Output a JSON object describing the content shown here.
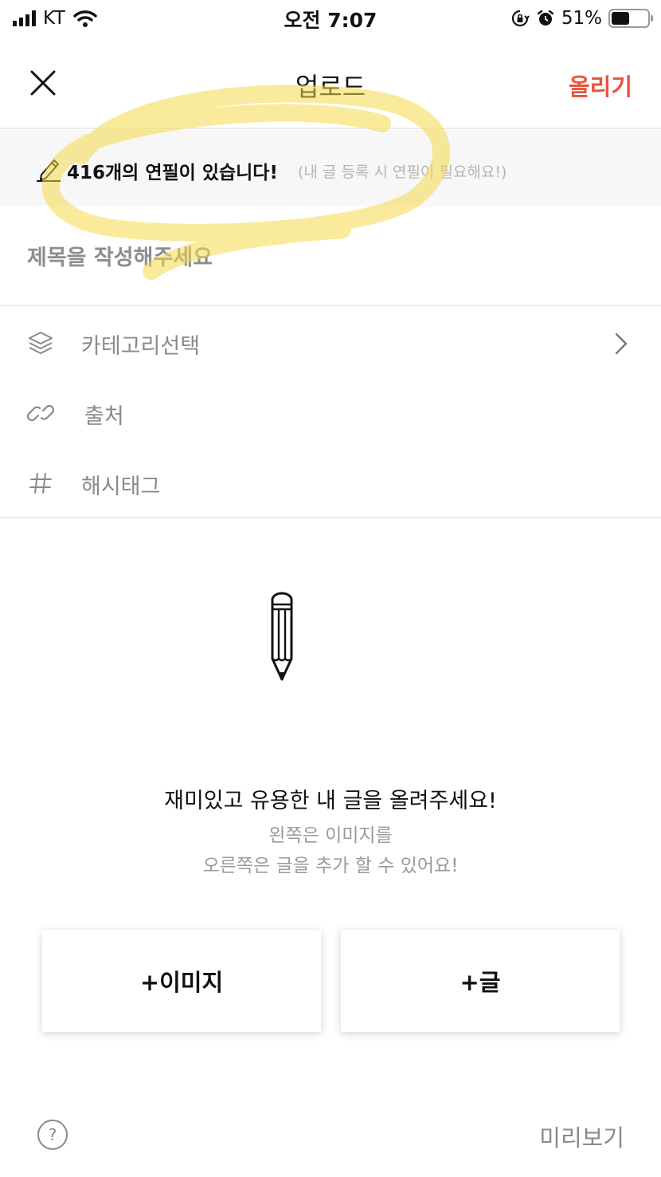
{
  "status_bar": {
    "carrier": "KT",
    "time": "오전 7:07",
    "battery_percent": "51%",
    "battery_level": 0.51,
    "icons": [
      "signal-icon",
      "wifi-icon",
      "rotation-lock-icon",
      "alarm-icon",
      "battery-icon"
    ]
  },
  "header": {
    "title": "업로드",
    "upload_label": "올리기",
    "close_icon": "close-icon"
  },
  "notice": {
    "main": "416개의 연필이 있습니다!",
    "sub": "(내 글 등록 시 연필이 필요해요!)",
    "icon": "pencil-icon"
  },
  "title_field": {
    "placeholder": "제목을 작성해주세요"
  },
  "options": [
    {
      "label": "카테고리선택",
      "icon": "layers-icon"
    },
    {
      "label": "출처",
      "icon": "link-icon"
    },
    {
      "label": "해시태그",
      "icon": "hashtag-icon"
    }
  ],
  "empty_state": {
    "title": "재미있고 유용한 내 글을 올려주세요!",
    "line1": "왼쪽은 이미지를",
    "line2": "오른쪽은 글을 추가 할 수 있어요!"
  },
  "buttons": {
    "add_image": "+이미지",
    "add_text": "+글"
  },
  "footer": {
    "help": "?",
    "preview": "미리보기"
  },
  "colors": {
    "accent": "#e8553d",
    "highlight": "#f5d94a"
  }
}
